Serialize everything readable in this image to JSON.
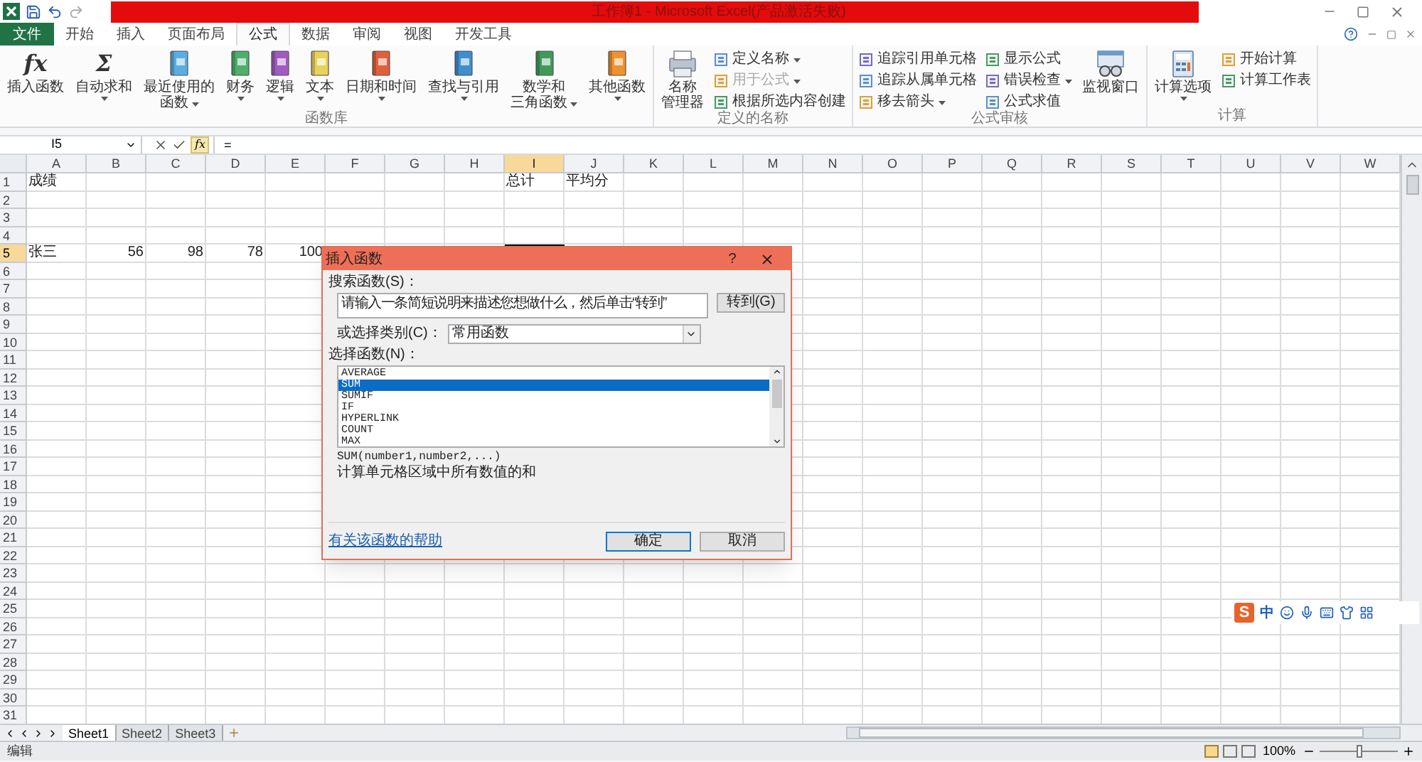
{
  "window": {
    "title": "工作簿1 - Microsoft Excel(产品激活失败)"
  },
  "file_tab": "文件",
  "tabs": [
    {
      "label": "开始",
      "selected": false
    },
    {
      "label": "插入",
      "selected": false
    },
    {
      "label": "页面布局",
      "selected": false
    },
    {
      "label": "公式",
      "selected": true
    },
    {
      "label": "数据",
      "selected": false
    },
    {
      "label": "审阅",
      "selected": false
    },
    {
      "label": "视图",
      "selected": false
    },
    {
      "label": "开发工具",
      "selected": false
    }
  ],
  "ribbon": [
    {
      "label": "函数库",
      "items": [
        {
          "kind": "large",
          "glyph": "fx",
          "lines": [
            "插入函数"
          ],
          "dropdown": false
        },
        {
          "kind": "large",
          "glyph": "Σ",
          "lines": [
            "自动求和"
          ],
          "dropdown": true
        },
        {
          "kind": "large",
          "color": "#5aaee0",
          "lines": [
            "最近使用的",
            "函数"
          ],
          "dropdown": true
        },
        {
          "kind": "large",
          "color": "#4caf6a",
          "lines": [
            "财务"
          ],
          "dropdown": true
        },
        {
          "kind": "large",
          "color": "#a05bc0",
          "lines": [
            "逻辑"
          ],
          "dropdown": true
        },
        {
          "kind": "large",
          "color": "#e8d25a",
          "lines": [
            "文本"
          ],
          "dropdown": true
        },
        {
          "kind": "large",
          "color": "#e0603a",
          "lines": [
            "日期和时间"
          ],
          "dropdown": true
        },
        {
          "kind": "large",
          "color": "#3f8fd0",
          "lines": [
            "查找与引用"
          ],
          "dropdown": true
        },
        {
          "kind": "large",
          "color": "#3f9a5a",
          "lines": [
            "数学和",
            "三角函数"
          ],
          "dropdown": true
        },
        {
          "kind": "large",
          "color": "#f0922e",
          "lines": [
            "其他函数"
          ],
          "dropdown": true
        }
      ]
    },
    {
      "label": "定义的名称",
      "items": [
        {
          "kind": "large",
          "lines": [
            "名称",
            "管理器"
          ],
          "dropdown": false
        },
        {
          "kind": "column",
          "buttons": [
            {
              "label": "定义名称",
              "dropdown": true,
              "disabled": false
            },
            {
              "label": "用于公式",
              "dropdown": true,
              "disabled": true
            },
            {
              "label": "根据所选内容创建",
              "dropdown": false,
              "disabled": false
            }
          ]
        }
      ]
    },
    {
      "label": "公式审核",
      "items": [
        {
          "kind": "column",
          "buttons": [
            {
              "label": "追踪引用单元格",
              "dropdown": false,
              "disabled": false
            },
            {
              "label": "追踪从属单元格",
              "dropdown": false,
              "disabled": false
            },
            {
              "label": "移去箭头",
              "dropdown": true,
              "disabled": false
            }
          ]
        },
        {
          "kind": "column",
          "buttons": [
            {
              "label": "显示公式",
              "dropdown": false,
              "disabled": false
            },
            {
              "label": "错误检查",
              "dropdown": true,
              "disabled": false
            },
            {
              "label": "公式求值",
              "dropdown": false,
              "disabled": false
            }
          ]
        },
        {
          "kind": "large",
          "lines": [
            "监视窗口"
          ],
          "dropdown": false
        }
      ]
    },
    {
      "label": "计算",
      "items": [
        {
          "kind": "large",
          "lines": [
            "计算选项"
          ],
          "dropdown": true
        },
        {
          "kind": "column",
          "buttons": [
            {
              "label": "开始计算",
              "dropdown": false,
              "disabled": false
            },
            {
              "label": "计算工作表",
              "dropdown": false,
              "disabled": false
            }
          ]
        }
      ]
    }
  ],
  "formula_bar": {
    "name_box": "I5",
    "insert_function": "fx",
    "value": "="
  },
  "sheet": {
    "columns": [
      {
        "label": "A",
        "selected": false
      },
      {
        "label": "B",
        "selected": false
      },
      {
        "label": "C",
        "selected": false
      },
      {
        "label": "D",
        "selected": false
      },
      {
        "label": "E",
        "selected": false
      },
      {
        "label": "F",
        "selected": false
      },
      {
        "label": "G",
        "selected": false
      },
      {
        "label": "H",
        "selected": false
      },
      {
        "label": "I",
        "selected": true
      },
      {
        "label": "J",
        "selected": false
      },
      {
        "label": "K",
        "selected": false
      },
      {
        "label": "L",
        "selected": false
      },
      {
        "label": "M",
        "selected": false
      },
      {
        "label": "N",
        "selected": false
      },
      {
        "label": "O",
        "selected": false
      },
      {
        "label": "P",
        "selected": false
      },
      {
        "label": "Q",
        "selected": false
      },
      {
        "label": "R",
        "selected": false
      },
      {
        "label": "S",
        "selected": false
      },
      {
        "label": "T",
        "selected": false
      },
      {
        "label": "U",
        "selected": false
      },
      {
        "label": "V",
        "selected": false
      },
      {
        "label": "W",
        "selected": false
      }
    ],
    "rows": [
      {
        "header": "1",
        "selected": false,
        "cells": [
          {
            "text": "成绩",
            "kind": "text"
          },
          null,
          null,
          null,
          null,
          null,
          null,
          null,
          {
            "text": "总计",
            "kind": "text"
          },
          {
            "text": "平均分",
            "kind": "text"
          }
        ]
      },
      {
        "header": "2",
        "selected": false
      },
      {
        "header": "3",
        "selected": false
      },
      {
        "header": "4",
        "selected": false
      },
      {
        "header": "5",
        "selected": true,
        "cells": [
          {
            "text": "张三",
            "kind": "text"
          },
          {
            "text": "56",
            "kind": "number"
          },
          {
            "text": "98",
            "kind": "number"
          },
          {
            "text": "78",
            "kind": "number"
          },
          {
            "text": "100",
            "kind": "number"
          },
          null,
          null,
          null,
          {
            "selected": true
          }
        ]
      },
      {
        "header": "6",
        "selected": false
      },
      {
        "header": "7",
        "selected": false
      },
      {
        "header": "8",
        "selected": false
      },
      {
        "header": "9",
        "selected": false
      },
      {
        "header": "10",
        "selected": false
      },
      {
        "header": "11",
        "selected": false
      },
      {
        "header": "12",
        "selected": false
      },
      {
        "header": "13",
        "selected": false
      },
      {
        "header": "14",
        "selected": false
      },
      {
        "header": "15",
        "selected": false
      },
      {
        "header": "16",
        "selected": false
      },
      {
        "header": "17",
        "selected": false
      },
      {
        "header": "18",
        "selected": false
      },
      {
        "header": "19",
        "selected": false
      },
      {
        "header": "20",
        "selected": false
      },
      {
        "header": "21",
        "selected": false
      },
      {
        "header": "22",
        "selected": false
      },
      {
        "header": "23",
        "selected": false
      },
      {
        "header": "24",
        "selected": false
      },
      {
        "header": "25",
        "selected": false
      },
      {
        "header": "26",
        "selected": false
      },
      {
        "header": "27",
        "selected": false
      },
      {
        "header": "28",
        "selected": false
      },
      {
        "header": "29",
        "selected": false
      },
      {
        "header": "30",
        "selected": false
      },
      {
        "header": "31",
        "selected": false
      }
    ]
  },
  "sheet_tabs": [
    {
      "label": "Sheet1",
      "selected": true
    },
    {
      "label": "Sheet2",
      "selected": false
    },
    {
      "label": "Sheet3",
      "selected": false
    }
  ],
  "status_bar": {
    "mode": "编辑",
    "zoom": "100%",
    "zoom_slider": {
      "level": 0.5
    }
  },
  "dialog": {
    "title": "插入函数",
    "help": "?",
    "search_label": "搜索函数(S)：",
    "search_value": "请输入一条简短说明来描述您想做什么，然后单击“转到”",
    "go_button": "转到(G)",
    "category_label": "或选择类别(C)：",
    "category_value": "常用函数",
    "list_label": "选择函数(N)：",
    "functions": [
      {
        "name": "AVERAGE",
        "selected": false
      },
      {
        "name": "SUM",
        "selected": true
      },
      {
        "name": "SUMIF",
        "selected": false
      },
      {
        "name": "IF",
        "selected": false
      },
      {
        "name": "HYPERLINK",
        "selected": false
      },
      {
        "name": "COUNT",
        "selected": false
      },
      {
        "name": "MAX",
        "selected": false
      }
    ],
    "signature": "SUM(number1,number2,...)",
    "description": "计算单元格区域中所有数值的和",
    "help_link": "有关该函数的帮助",
    "ok": "确定",
    "cancel": "取消"
  },
  "ime_toolbar": {
    "logo": "S",
    "mode": "中"
  }
}
